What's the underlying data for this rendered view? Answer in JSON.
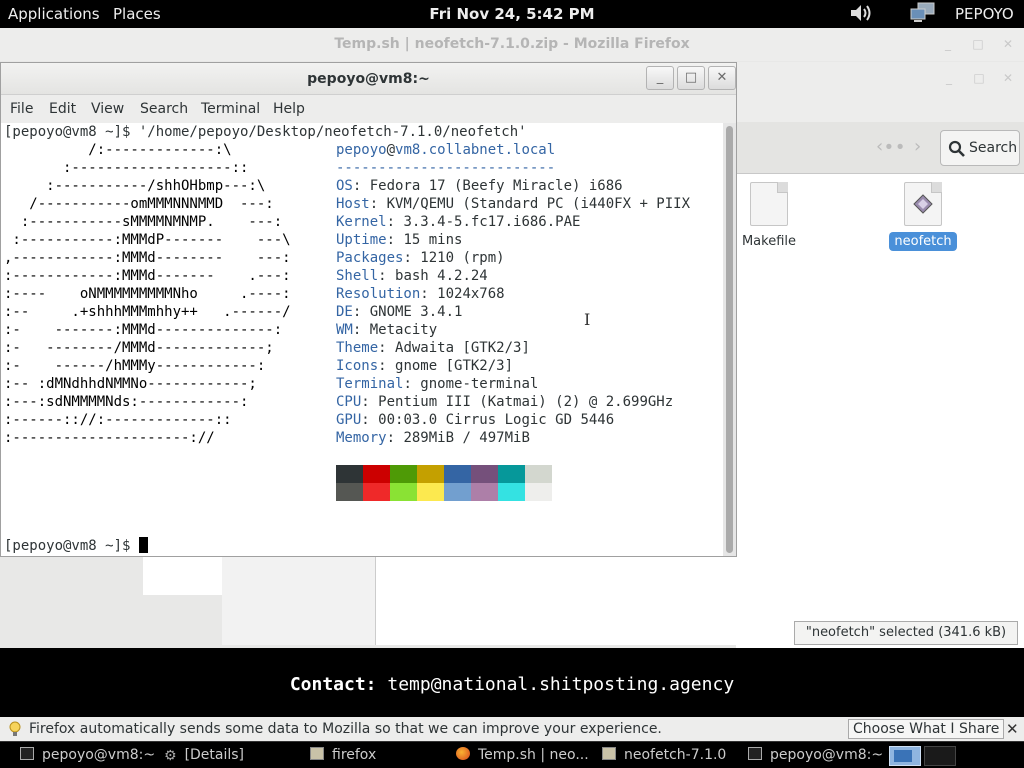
{
  "top_panel": {
    "applications": "Applications",
    "places": "Places",
    "clock": "Fri Nov 24,  5:42 PM",
    "user": "PEPOYO",
    "icons": [
      "volume-icon",
      "network-icon"
    ]
  },
  "firefox": {
    "title": "Temp.sh | neofetch-7.1.0.zip - Mozilla Firefox"
  },
  "files": {
    "search_label": "Search",
    "items": [
      {
        "label": "Makefile",
        "selected": false
      },
      {
        "label": "neofetch",
        "selected": true
      }
    ],
    "status": "\"neofetch\" selected (341.6 kB)"
  },
  "terminal": {
    "title": "pepoyo@vm8:~",
    "menu": [
      "File",
      "Edit",
      "View",
      "Search",
      "Terminal",
      "Help"
    ],
    "command_line": "[pepoyo@vm8 ~]$ '/home/pepoyo/Desktop/neofetch-7.1.0/neofetch'",
    "art": [
      "          /:-------------:\\",
      "       :-------------------::",
      "     :-----------/shhOHbmp---:\\",
      "   /-----------omMMMNNNMMD  ---:",
      "  :-----------sMMMMNMNMP.    ---:",
      " :-----------:MMMdP-------    ---\\",
      ",------------:MMMd--------    ---:",
      ":------------:MMMd-------    .---:",
      ":----    oNMMMMMMMMMNho     .----:",
      ":--     .+shhhMMMmhhy++   .------/",
      ":-    -------:MMMd--------------:",
      ":-   --------/MMMd-------------;",
      ":-    ------/hMMMy------------:",
      ":-- :dMNdhhdNMMNo------------;",
      ":---:sdNMMMMNds:------------:",
      ":------:://:-------------::",
      ":---------------------://"
    ],
    "user_host_user": "pepoyo",
    "user_host_at": "@",
    "user_host_host": "vm8.collabnet.local",
    "separator": "--------------------------",
    "info": [
      {
        "key": "OS",
        "value": "Fedora 17 (Beefy Miracle) i686"
      },
      {
        "key": "Host",
        "value": "KVM/QEMU (Standard PC (i440FX + PIIX"
      },
      {
        "key": "Kernel",
        "value": "3.3.4-5.fc17.i686.PAE"
      },
      {
        "key": "Uptime",
        "value": "15 mins"
      },
      {
        "key": "Packages",
        "value": "1210 (rpm)"
      },
      {
        "key": "Shell",
        "value": "bash 4.2.24"
      },
      {
        "key": "Resolution",
        "value": "1024x768"
      },
      {
        "key": "DE",
        "value": "GNOME 3.4.1"
      },
      {
        "key": "WM",
        "value": "Metacity"
      },
      {
        "key": "Theme",
        "value": "Adwaita [GTK2/3]"
      },
      {
        "key": "Icons",
        "value": "gnome [GTK2/3]"
      },
      {
        "key": "Terminal",
        "value": "gnome-terminal"
      },
      {
        "key": "CPU",
        "value": "Pentium III (Katmai) (2) @ 2.699GHz"
      },
      {
        "key": "GPU",
        "value": "00:03.0 Cirrus Logic GD 5446"
      },
      {
        "key": "Memory",
        "value": "289MiB / 497MiB"
      }
    ],
    "palette_dark": [
      "#2e3436",
      "#cc0000",
      "#4e9a06",
      "#c4a000",
      "#3465a4",
      "#75507b",
      "#06989a",
      "#d3d7cf"
    ],
    "palette_light": [
      "#555753",
      "#ef2929",
      "#8ae234",
      "#fce94f",
      "#729fcf",
      "#ad7fa8",
      "#34e2e2",
      "#eeeeec"
    ],
    "prompt": "[pepoyo@vm8 ~]$ "
  },
  "banner": {
    "label": "Contact:",
    "value": "temp@national.shitposting.agency"
  },
  "notification": {
    "text": "Firefox automatically sends some data to Mozilla so that we can improve your experience.",
    "button": "Choose What I Share",
    "close": "✕"
  },
  "taskbar": {
    "tasks": [
      {
        "label": "pepoyo@vm8:~",
        "icon": "terminal-icon"
      },
      {
        "label": "[Details]",
        "icon": "gear-icon"
      },
      {
        "label": "firefox",
        "icon": "folder-icon"
      },
      {
        "label": "Temp.sh | neo...",
        "icon": "firefox-icon"
      },
      {
        "label": "neofetch-7.1.0",
        "icon": "folder-icon"
      },
      {
        "label": "pepoyo@vm8:~",
        "icon": "terminal-icon"
      }
    ]
  }
}
